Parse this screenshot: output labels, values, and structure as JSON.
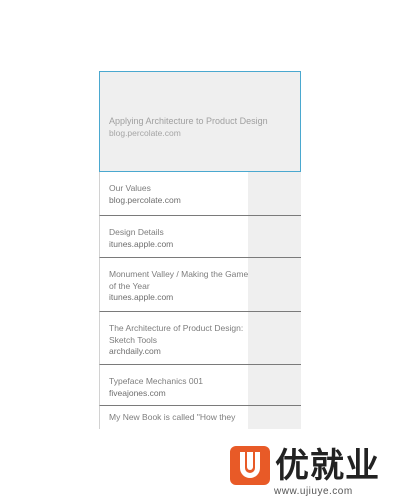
{
  "featured": {
    "title": "Applying Architecture to Product Design",
    "source": "blog.percolate.com"
  },
  "items": [
    {
      "title": "Our Values",
      "source": "blog.percolate.com"
    },
    {
      "title": "Design Details",
      "source": "itunes.apple.com"
    },
    {
      "title": "Monument Valley / Making the Game of the Year",
      "source": "itunes.apple.com"
    },
    {
      "title": "The Architecture of Product Design: Sketch Tools",
      "source": "archdaily.com"
    },
    {
      "title": "Typeface Mechanics 001",
      "source": "fiveajones.com"
    },
    {
      "title": "My New Book is called \"How they",
      "source": ""
    }
  ],
  "watermark": {
    "brand": "优就业",
    "url": "www.ujiuye.com"
  }
}
